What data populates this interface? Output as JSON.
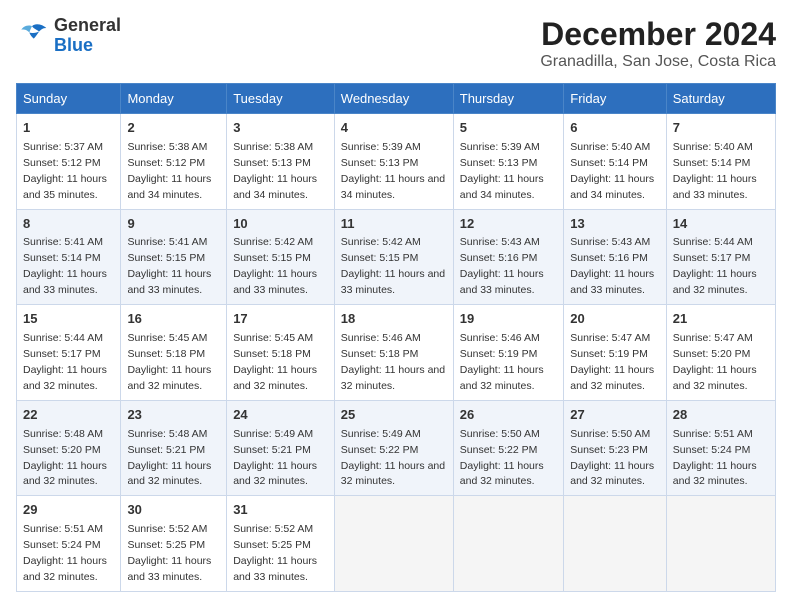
{
  "header": {
    "logo_general": "General",
    "logo_blue": "Blue",
    "month_year": "December 2024",
    "location": "Granadilla, San Jose, Costa Rica"
  },
  "days_of_week": [
    "Sunday",
    "Monday",
    "Tuesday",
    "Wednesday",
    "Thursday",
    "Friday",
    "Saturday"
  ],
  "weeks": [
    [
      {
        "day": 1,
        "sunrise": "5:37 AM",
        "sunset": "5:12 PM",
        "daylight": "11 hours and 35 minutes."
      },
      {
        "day": 2,
        "sunrise": "5:38 AM",
        "sunset": "5:12 PM",
        "daylight": "11 hours and 34 minutes."
      },
      {
        "day": 3,
        "sunrise": "5:38 AM",
        "sunset": "5:13 PM",
        "daylight": "11 hours and 34 minutes."
      },
      {
        "day": 4,
        "sunrise": "5:39 AM",
        "sunset": "5:13 PM",
        "daylight": "11 hours and 34 minutes."
      },
      {
        "day": 5,
        "sunrise": "5:39 AM",
        "sunset": "5:13 PM",
        "daylight": "11 hours and 34 minutes."
      },
      {
        "day": 6,
        "sunrise": "5:40 AM",
        "sunset": "5:14 PM",
        "daylight": "11 hours and 34 minutes."
      },
      {
        "day": 7,
        "sunrise": "5:40 AM",
        "sunset": "5:14 PM",
        "daylight": "11 hours and 33 minutes."
      }
    ],
    [
      {
        "day": 8,
        "sunrise": "5:41 AM",
        "sunset": "5:14 PM",
        "daylight": "11 hours and 33 minutes."
      },
      {
        "day": 9,
        "sunrise": "5:41 AM",
        "sunset": "5:15 PM",
        "daylight": "11 hours and 33 minutes."
      },
      {
        "day": 10,
        "sunrise": "5:42 AM",
        "sunset": "5:15 PM",
        "daylight": "11 hours and 33 minutes."
      },
      {
        "day": 11,
        "sunrise": "5:42 AM",
        "sunset": "5:15 PM",
        "daylight": "11 hours and 33 minutes."
      },
      {
        "day": 12,
        "sunrise": "5:43 AM",
        "sunset": "5:16 PM",
        "daylight": "11 hours and 33 minutes."
      },
      {
        "day": 13,
        "sunrise": "5:43 AM",
        "sunset": "5:16 PM",
        "daylight": "11 hours and 33 minutes."
      },
      {
        "day": 14,
        "sunrise": "5:44 AM",
        "sunset": "5:17 PM",
        "daylight": "11 hours and 32 minutes."
      }
    ],
    [
      {
        "day": 15,
        "sunrise": "5:44 AM",
        "sunset": "5:17 PM",
        "daylight": "11 hours and 32 minutes."
      },
      {
        "day": 16,
        "sunrise": "5:45 AM",
        "sunset": "5:18 PM",
        "daylight": "11 hours and 32 minutes."
      },
      {
        "day": 17,
        "sunrise": "5:45 AM",
        "sunset": "5:18 PM",
        "daylight": "11 hours and 32 minutes."
      },
      {
        "day": 18,
        "sunrise": "5:46 AM",
        "sunset": "5:18 PM",
        "daylight": "11 hours and 32 minutes."
      },
      {
        "day": 19,
        "sunrise": "5:46 AM",
        "sunset": "5:19 PM",
        "daylight": "11 hours and 32 minutes."
      },
      {
        "day": 20,
        "sunrise": "5:47 AM",
        "sunset": "5:19 PM",
        "daylight": "11 hours and 32 minutes."
      },
      {
        "day": 21,
        "sunrise": "5:47 AM",
        "sunset": "5:20 PM",
        "daylight": "11 hours and 32 minutes."
      }
    ],
    [
      {
        "day": 22,
        "sunrise": "5:48 AM",
        "sunset": "5:20 PM",
        "daylight": "11 hours and 32 minutes."
      },
      {
        "day": 23,
        "sunrise": "5:48 AM",
        "sunset": "5:21 PM",
        "daylight": "11 hours and 32 minutes."
      },
      {
        "day": 24,
        "sunrise": "5:49 AM",
        "sunset": "5:21 PM",
        "daylight": "11 hours and 32 minutes."
      },
      {
        "day": 25,
        "sunrise": "5:49 AM",
        "sunset": "5:22 PM",
        "daylight": "11 hours and 32 minutes."
      },
      {
        "day": 26,
        "sunrise": "5:50 AM",
        "sunset": "5:22 PM",
        "daylight": "11 hours and 32 minutes."
      },
      {
        "day": 27,
        "sunrise": "5:50 AM",
        "sunset": "5:23 PM",
        "daylight": "11 hours and 32 minutes."
      },
      {
        "day": 28,
        "sunrise": "5:51 AM",
        "sunset": "5:24 PM",
        "daylight": "11 hours and 32 minutes."
      }
    ],
    [
      {
        "day": 29,
        "sunrise": "5:51 AM",
        "sunset": "5:24 PM",
        "daylight": "11 hours and 32 minutes."
      },
      {
        "day": 30,
        "sunrise": "5:52 AM",
        "sunset": "5:25 PM",
        "daylight": "11 hours and 33 minutes."
      },
      {
        "day": 31,
        "sunrise": "5:52 AM",
        "sunset": "5:25 PM",
        "daylight": "11 hours and 33 minutes."
      },
      null,
      null,
      null,
      null
    ]
  ],
  "labels": {
    "sunrise": "Sunrise:",
    "sunset": "Sunset:",
    "daylight": "Daylight:"
  }
}
